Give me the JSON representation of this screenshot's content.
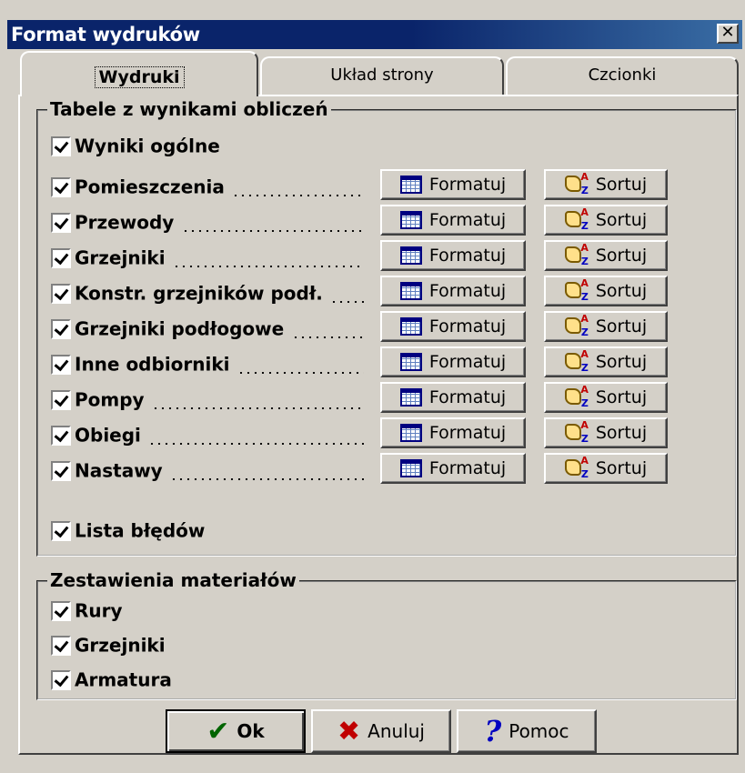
{
  "window": {
    "title": "Format wydruków",
    "close_glyph": "✕"
  },
  "tabs": [
    {
      "label": "Wydruki",
      "active": true
    },
    {
      "label": "Układ strony",
      "active": false
    },
    {
      "label": "Czcionki",
      "active": false
    }
  ],
  "tables_group": {
    "label": "Tabele z wynikami obliczeń",
    "items": [
      {
        "label": "Wyniki ogólne",
        "checked": true,
        "has_buttons": false
      },
      {
        "label": "Pomieszczenia",
        "checked": true,
        "has_buttons": true
      },
      {
        "label": "Przewody",
        "checked": true,
        "has_buttons": true
      },
      {
        "label": "Grzejniki",
        "checked": true,
        "has_buttons": true
      },
      {
        "label": "Konstr. grzejników podł.",
        "checked": true,
        "has_buttons": true
      },
      {
        "label": "Grzejniki podłogowe",
        "checked": true,
        "has_buttons": true
      },
      {
        "label": "Inne odbiorniki",
        "checked": true,
        "has_buttons": true
      },
      {
        "label": "Pompy",
        "checked": true,
        "has_buttons": true
      },
      {
        "label": "Obiegi",
        "checked": true,
        "has_buttons": true
      },
      {
        "label": "Nastawy",
        "checked": true,
        "has_buttons": true
      },
      {
        "label": "Lista błędów",
        "checked": true,
        "has_buttons": false
      }
    ],
    "format_label": "Formatuj",
    "sort_label": "Sortuj",
    "format_icon": "table-icon",
    "sort_icon": "sort-icon"
  },
  "materials_group": {
    "label": "Zestawienia materiałów",
    "items": [
      {
        "label": "Rury",
        "checked": true
      },
      {
        "label": "Grzejniki",
        "checked": true
      },
      {
        "label": "Armatura",
        "checked": true
      }
    ]
  },
  "footer": {
    "ok_label": "Ok",
    "cancel_label": "Anuluj",
    "help_label": "Pomoc",
    "ok_icon": "checkmark-icon",
    "cancel_icon": "x-icon",
    "help_icon": "question-icon"
  },
  "colors": {
    "face": "#d4d0c8",
    "title_bar": "#0a246a",
    "ok_icon": "#006400",
    "cancel_icon": "#c00000",
    "help_icon": "#0000c0"
  }
}
